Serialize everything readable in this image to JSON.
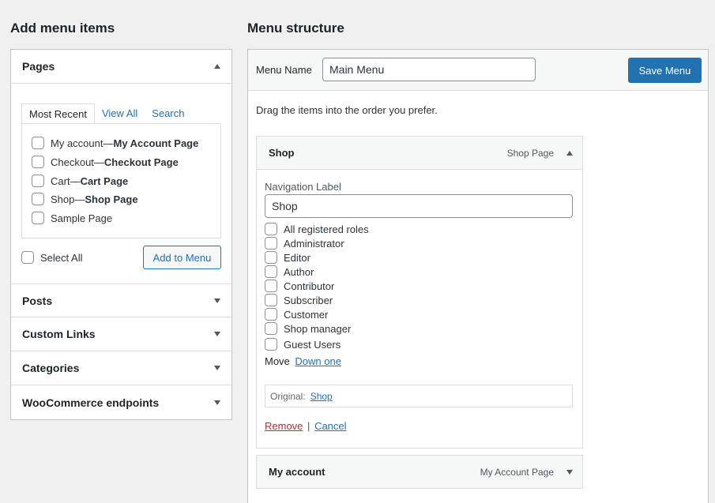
{
  "left": {
    "heading": "Add menu items",
    "pages": {
      "title": "Pages",
      "tabs": [
        "Most Recent",
        "View All",
        "Search"
      ],
      "items": [
        {
          "title": "My account",
          "sep": " — ",
          "state": "My Account Page"
        },
        {
          "title": "Checkout",
          "sep": " — ",
          "state": "Checkout Page"
        },
        {
          "title": "Cart",
          "sep": " — ",
          "state": "Cart Page"
        },
        {
          "title": "Shop",
          "sep": " — ",
          "state": "Shop Page"
        },
        {
          "title": "Sample Page",
          "sep": "",
          "state": ""
        }
      ],
      "select_all": "Select All",
      "add_button": "Add to Menu"
    },
    "sections": [
      "Posts",
      "Custom Links",
      "Categories",
      "WooCommerce endpoints"
    ]
  },
  "right": {
    "heading": "Menu structure",
    "menu_name_label": "Menu Name",
    "menu_name_value": "Main Menu",
    "save_button": "Save Menu",
    "instructions": "Drag the items into the order you prefer.",
    "items": [
      {
        "title": "Shop",
        "type": "Shop Page",
        "nav_label_caption": "Navigation Label",
        "nav_label_value": "Shop",
        "roles": [
          "All registered roles",
          "Administrator",
          "Editor",
          "Author",
          "Contributor",
          "Subscriber",
          "Customer",
          "Shop manager",
          "Guest Users"
        ],
        "move_label": "Move",
        "move_link": "Down one",
        "original_label": "Original:",
        "original_link": "Shop",
        "remove": "Remove",
        "separator": "|",
        "cancel": "Cancel"
      },
      {
        "title": "My account",
        "type": "My Account Page"
      }
    ]
  },
  "colors": {
    "accent": "#2271b1",
    "remove": "#b32d2e",
    "background": "#f0f0f1"
  }
}
